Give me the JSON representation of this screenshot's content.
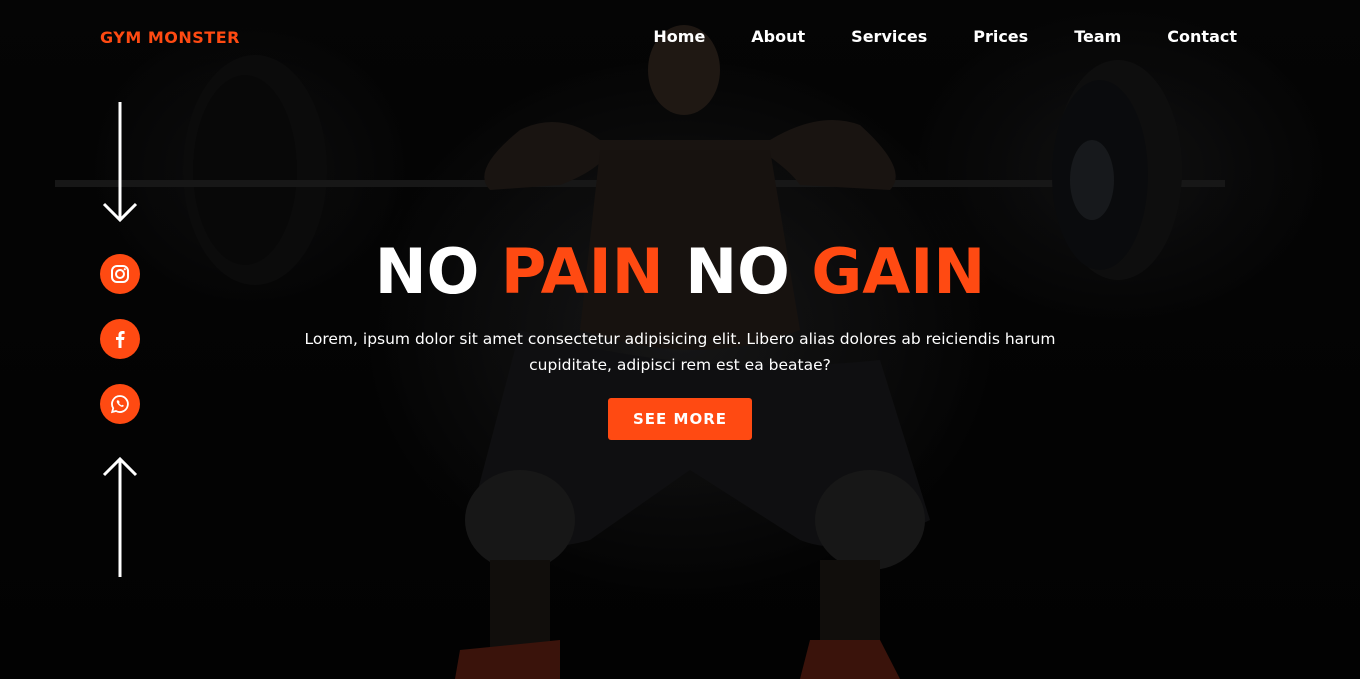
{
  "brand": {
    "logo_text": "GYM MONSTER",
    "accent_color": "#ff4a12"
  },
  "nav": {
    "items": [
      {
        "label": "Home"
      },
      {
        "label": "About"
      },
      {
        "label": "Services"
      },
      {
        "label": "Prices"
      },
      {
        "label": "Team"
      },
      {
        "label": "Contact"
      }
    ]
  },
  "side": {
    "icons": [
      "arrow-down-icon",
      "instagram-icon",
      "facebook-icon",
      "whatsapp-icon",
      "arrow-up-icon"
    ]
  },
  "hero": {
    "headline": {
      "part1": "NO",
      "part2": "PAIN",
      "part3": "NO",
      "part4": "GAIN"
    },
    "subtitle": "Lorem, ipsum dolor sit amet consectetur adipisicing elit. Libero alias dolores ab reiciendis harum cupiditate, adipisci rem est ea beatae?",
    "cta_label": "SEE MORE",
    "background_image": "weightlifter-squat-photo"
  }
}
